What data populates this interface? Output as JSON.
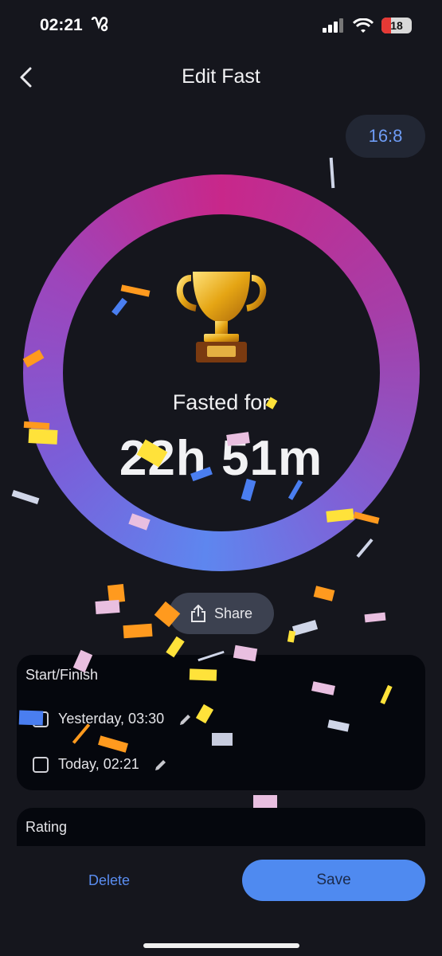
{
  "status_bar": {
    "time": "02:21",
    "battery": "18"
  },
  "header": {
    "title": "Edit Fast",
    "plan": "16:8"
  },
  "summary": {
    "label": "Fasted for",
    "duration": "22h 51m"
  },
  "share": {
    "label": "Share"
  },
  "start_finish": {
    "heading": "Start/Finish",
    "start": "Yesterday, 03:30",
    "finish": "Today, 02:21"
  },
  "rating": {
    "heading": "Rating"
  },
  "actions": {
    "delete": "Delete",
    "save": "Save"
  },
  "colors": {
    "accent": "#4f8af0",
    "ring_start": "#c8278a",
    "ring_end": "#5e86ef",
    "background": "#15161d",
    "card": "#05070d"
  },
  "icons": [
    "heartbeat-icon",
    "signal-icon",
    "wifi-icon",
    "battery-icon",
    "back-chevron-icon",
    "trophy-icon",
    "share-icon",
    "checkbox-icon",
    "pencil-icon"
  ]
}
